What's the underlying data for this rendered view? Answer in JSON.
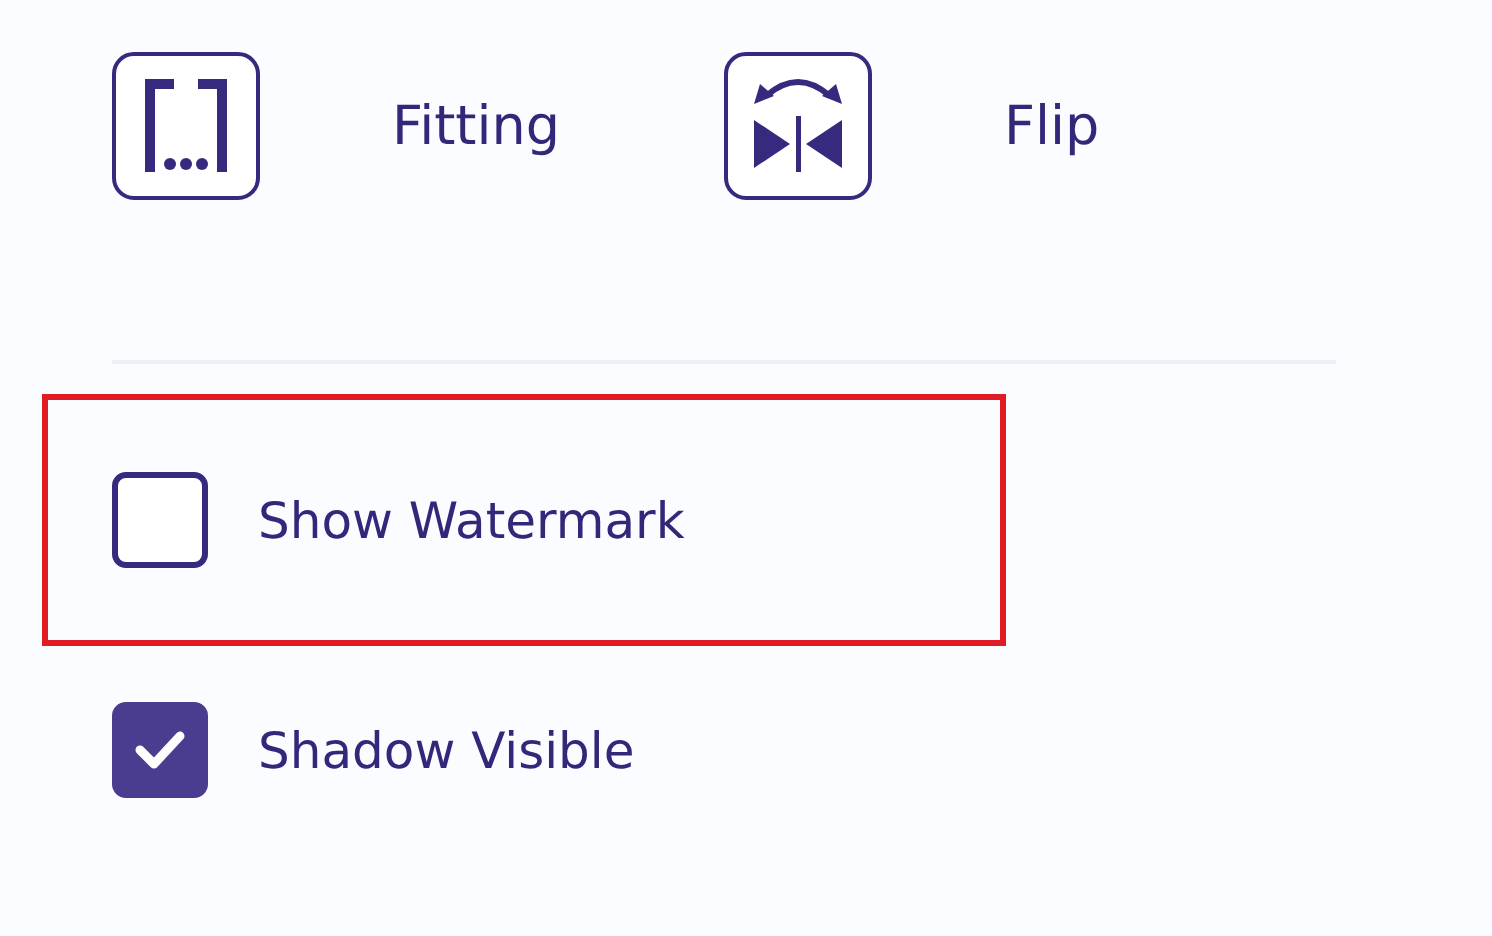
{
  "tools": [
    {
      "kind": "fitting",
      "label": "Fitting"
    },
    {
      "kind": "flip",
      "label": "Flip"
    }
  ],
  "options": [
    {
      "label": "Show Watermark",
      "checked": false,
      "highlighted": true
    },
    {
      "label": "Shadow Visible",
      "checked": true,
      "highlighted": false
    }
  ]
}
